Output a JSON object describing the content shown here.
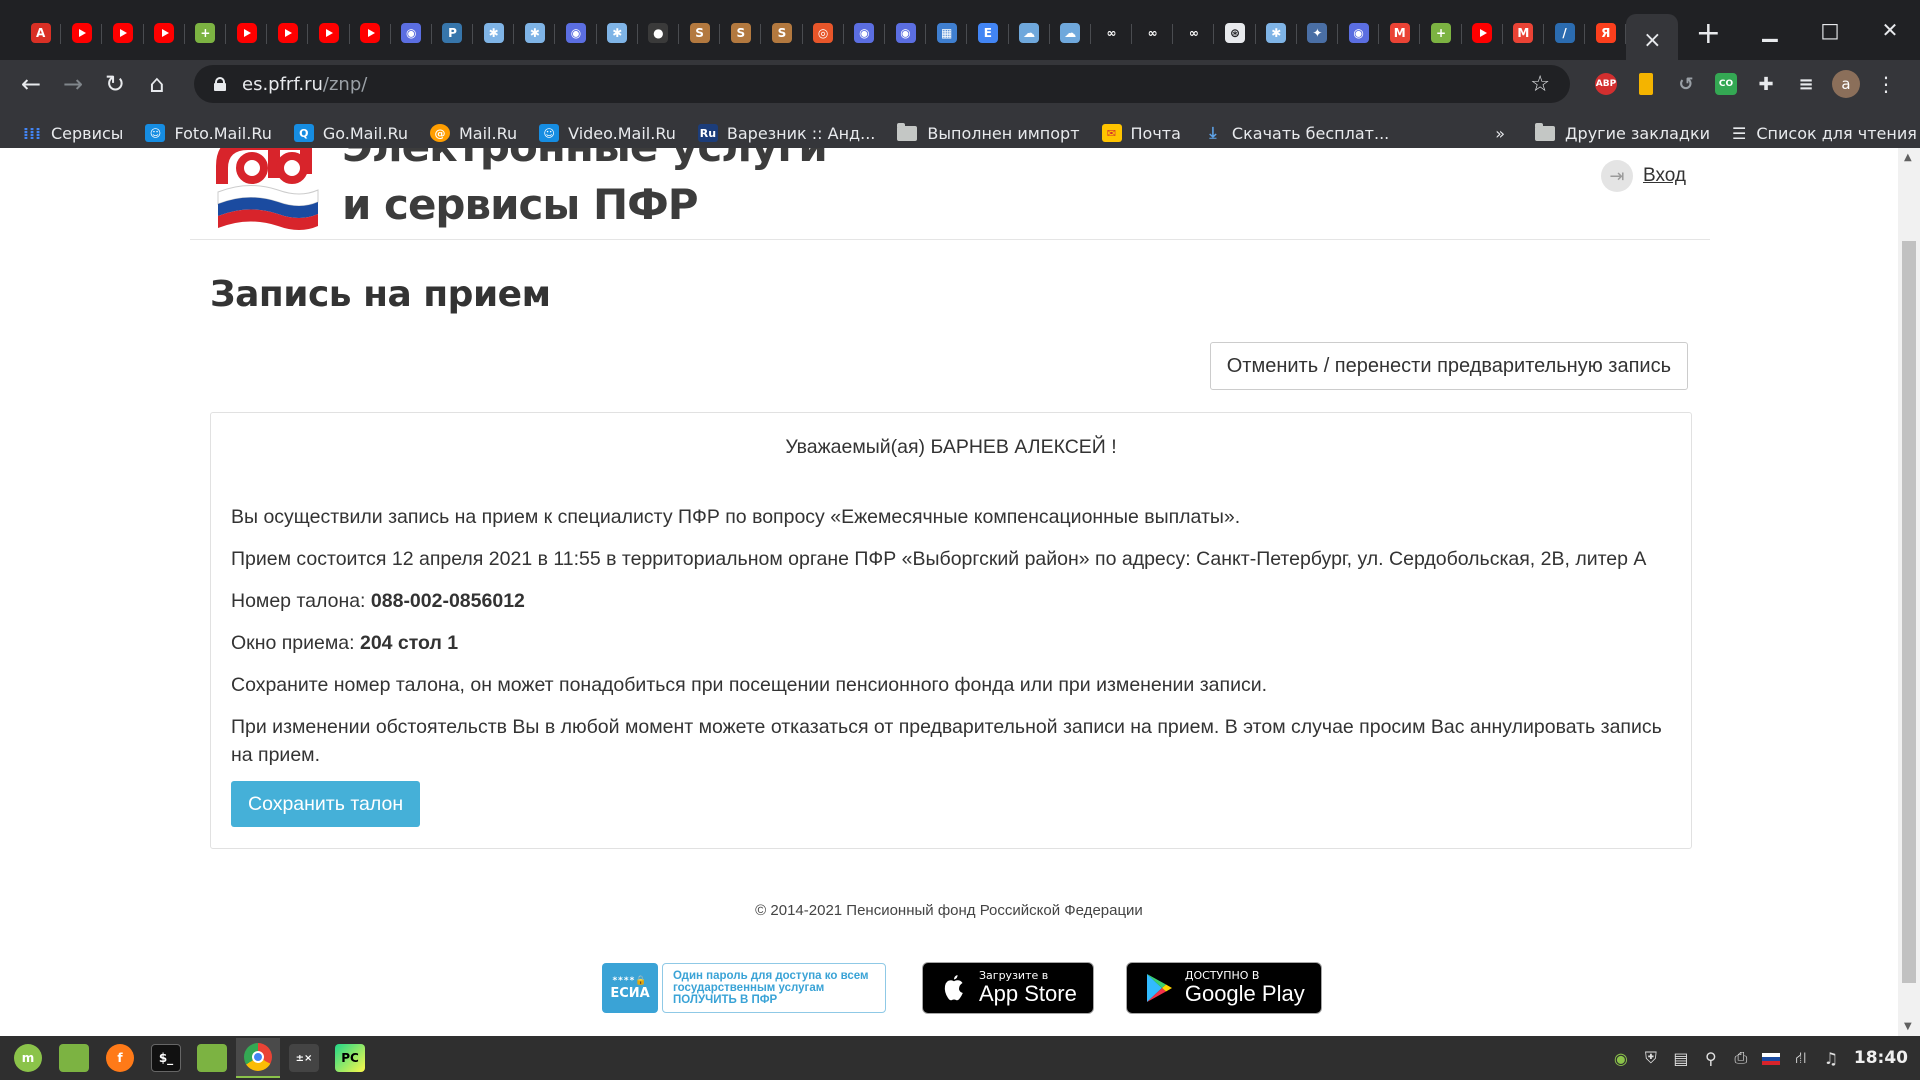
{
  "browser": {
    "tabs": [
      {
        "icon": "acrobat-icon",
        "color": "#d93025",
        "glyph": "A"
      },
      {
        "icon": "youtube-icon",
        "color": "#ff0000",
        "glyph": ""
      },
      {
        "icon": "youtube-icon",
        "color": "#ff0000",
        "glyph": ""
      },
      {
        "icon": "youtube-icon",
        "color": "#ff0000",
        "glyph": ""
      },
      {
        "icon": "android-icon",
        "color": "#7cb342",
        "glyph": "+"
      },
      {
        "icon": "youtube-icon",
        "color": "#ff0000",
        "glyph": ""
      },
      {
        "icon": "youtube-icon",
        "color": "#ff0000",
        "glyph": ""
      },
      {
        "icon": "youtube-icon",
        "color": "#ff0000",
        "glyph": ""
      },
      {
        "icon": "youtube-icon",
        "color": "#ff0000",
        "glyph": ""
      },
      {
        "icon": "globe-icon",
        "color": "#5b6ee1",
        "glyph": "◉"
      },
      {
        "icon": "python-icon",
        "color": "#3776ab",
        "glyph": "P"
      },
      {
        "icon": "sparkle-icon",
        "color": "#7fb4e6",
        "glyph": "✱"
      },
      {
        "icon": "sparkle-icon",
        "color": "#7fb4e6",
        "glyph": "✱"
      },
      {
        "icon": "globe-icon",
        "color": "#5b6ee1",
        "glyph": "◉"
      },
      {
        "icon": "sparkle-icon",
        "color": "#7fb4e6",
        "glyph": "✱"
      },
      {
        "icon": "github-icon",
        "color": "#3a3a3a",
        "glyph": "●"
      },
      {
        "icon": "sublime-icon",
        "color": "#b3793f",
        "glyph": "S"
      },
      {
        "icon": "sublime-icon",
        "color": "#b3793f",
        "glyph": "S"
      },
      {
        "icon": "sublime-icon",
        "color": "#b3793f",
        "glyph": "S"
      },
      {
        "icon": "target-icon",
        "color": "#e8562a",
        "glyph": "◎"
      },
      {
        "icon": "globe-icon",
        "color": "#5b6ee1",
        "glyph": "◉"
      },
      {
        "icon": "globe-icon",
        "color": "#5b6ee1",
        "glyph": "◉"
      },
      {
        "icon": "grid-icon",
        "color": "#3f7fd0",
        "glyph": "▦"
      },
      {
        "icon": "document-icon",
        "color": "#4285f4",
        "glyph": "E"
      },
      {
        "icon": "cloud-icon",
        "color": "#6fa8dc",
        "glyph": "☁"
      },
      {
        "icon": "cloud-icon",
        "color": "#6fa8dc",
        "glyph": "☁"
      },
      {
        "icon": "link-icon",
        "color": "#202124",
        "glyph": "∞"
      },
      {
        "icon": "link-icon",
        "color": "#202124",
        "glyph": "∞"
      },
      {
        "icon": "link-icon",
        "color": "#202124",
        "glyph": "∞"
      },
      {
        "icon": "openai-icon",
        "color": "#e8eaed",
        "glyph": "⊛"
      },
      {
        "icon": "sparkle-icon",
        "color": "#7fb4e6",
        "glyph": "✱"
      },
      {
        "icon": "star-icon",
        "color": "#4a6fa5",
        "glyph": "✦"
      },
      {
        "icon": "globe-icon",
        "color": "#5b6ee1",
        "glyph": "◉"
      },
      {
        "icon": "gmail-icon",
        "color": "#ea4335",
        "glyph": "M"
      },
      {
        "icon": "android-icon",
        "color": "#7cb342",
        "glyph": "+"
      },
      {
        "icon": "youtube-icon",
        "color": "#ff0000",
        "glyph": ""
      },
      {
        "icon": "gmail-icon",
        "color": "#ea4335",
        "glyph": "M"
      },
      {
        "icon": "feather-icon",
        "color": "#2b6cb0",
        "glyph": "/"
      },
      {
        "icon": "yandex-icon",
        "color": "#fc3f1d",
        "glyph": "Я"
      }
    ],
    "active_tab_close": "×",
    "new_tab": "+",
    "url_host": "es.pfrf.ru",
    "url_path": "/znp/",
    "avatar_letter": "a",
    "bookmarks": [
      {
        "label": "Сервисы",
        "icon": "apps-grid-icon",
        "color": "#4285f4"
      },
      {
        "label": "Foto.Mail.Ru",
        "icon": "foto-mail-icon",
        "color": "#168de2"
      },
      {
        "label": "Go.Mail.Ru",
        "icon": "go-mail-icon",
        "color": "#168de2"
      },
      {
        "label": "Mail.Ru",
        "icon": "mailru-at-icon",
        "color": "#168de2"
      },
      {
        "label": "Video.Mail.Ru",
        "icon": "video-mail-icon",
        "color": "#168de2"
      },
      {
        "label": "Варезник :: Анд...",
        "icon": "ru-site-icon",
        "color": "#1c3d7a"
      },
      {
        "label": "Выполнен импорт",
        "icon": "folder-icon",
        "color": "#c4c7c5"
      },
      {
        "label": "Почта",
        "icon": "mail-envelope-icon",
        "color": "#ffc400"
      },
      {
        "label": "Скачать бесплат...",
        "icon": "download-site-icon",
        "color": "#2b6cb0"
      }
    ],
    "bookmarks_overflow": "»",
    "other_bookmarks": "Другие закладки",
    "reading_list": "Список для чтения"
  },
  "page": {
    "site_title_line1": "Электронные услуги",
    "site_title_line2": "и сервисы ПФР",
    "login_label": "Вход",
    "heading": "Запись на прием",
    "cancel_button": "Отменить / перенести предварительную запись",
    "greeting": "Уважаемый(ая) БАРНЕВ АЛЕКСЕЙ !",
    "line1": "Вы осуществили запись на прием к специалисту ПФР по вопросу «Ежемесячные компенсационные выплаты».",
    "line2": "Прием состоится 12 апреля 2021 в 11:55 в территориальном органе ПФР «Выборгский район» по адресу: Санкт-Петербург, ул. Сердобольская, 2В, литер А",
    "ticket_label": "Номер талона:",
    "ticket_value": "088-002-0856012",
    "window_label": "Окно приема:",
    "window_value": "204 стол 1",
    "line5": "Сохраните номер талона, он может понадобиться при посещении пенсионного фонда или при изменении записи.",
    "line6": "При изменении обстоятельств Вы в любой момент можете отказаться от предварительной записи на прием. В этом случае просим Вас аннулировать запись на прием.",
    "save_button": "Сохранить талон",
    "copyright": "© 2014-2021 Пенсионный фонд Российской Федерации",
    "esia_logo": "ЕСИА",
    "esia_text": "Один пароль для доступа ко всем государственным услугам ПОЛУЧИТЬ В ПФР",
    "appstore_small": "Загрузите в",
    "appstore_big": "App Store",
    "gplay_small": "ДОСТУПНО В",
    "gplay_big": "Google Play"
  },
  "colors": {
    "primary_button": "#45b0d8",
    "chrome_dark": "#202124",
    "chrome_toolbar": "#35363a"
  },
  "taskbar": {
    "apps": [
      "mint-menu-icon",
      "files-icon",
      "firefox-icon",
      "terminal-icon",
      "folder-icon",
      "chrome-icon",
      "calculator-icon",
      "pycharm-icon"
    ],
    "clock": "18:40"
  }
}
